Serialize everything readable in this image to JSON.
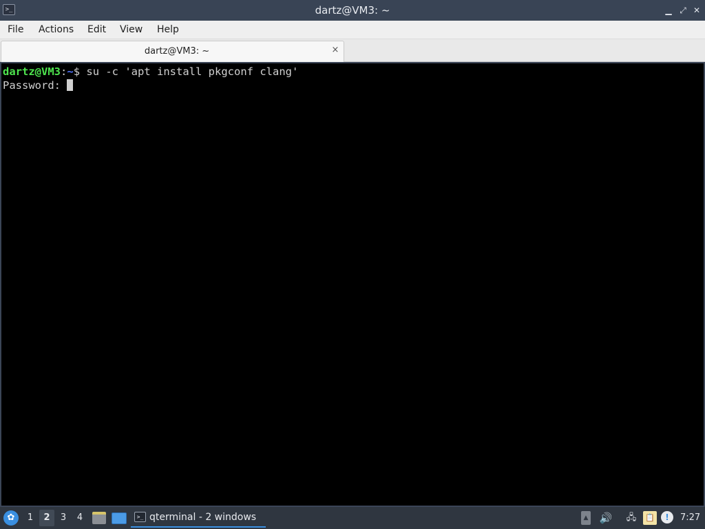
{
  "window": {
    "title": "dartz@VM3: ~",
    "app_icon": ">_",
    "minimize_icon": "▁",
    "restore_icon": "⤢",
    "close_icon": "✕"
  },
  "menu": {
    "file": "File",
    "actions": "Actions",
    "edit": "Edit",
    "view": "View",
    "help": "Help"
  },
  "tabs": [
    {
      "label": "dartz@VM3: ~",
      "close_icon": "×"
    }
  ],
  "terminal": {
    "prompt_user": "dartz@VM3",
    "prompt_sep": ":",
    "prompt_path": "~",
    "prompt_symbol": "$ ",
    "command": "su -c 'apt install pkgconf clang'",
    "password_prompt": "Password: ",
    "colors": {
      "user": "#4ee44e",
      "path": "#4f73ff",
      "text": "#d0d0d0"
    }
  },
  "taskbar": {
    "start_icon": "✿",
    "workspaces": [
      "1",
      "2",
      "3",
      "4"
    ],
    "active_workspace": "2",
    "task": {
      "label": "qterminal - 2 windows",
      "icon": ">_"
    },
    "tray": {
      "updown_icon": "▲",
      "volume_icon": "🔊",
      "network_icon": "🖧",
      "clipboard_icon": "📋",
      "notify_icon": "!"
    },
    "clock": "7:27"
  },
  "colors": {
    "titlebar": "#394455",
    "taskbar": "#2f3640",
    "accent": "#3a8fe0"
  }
}
